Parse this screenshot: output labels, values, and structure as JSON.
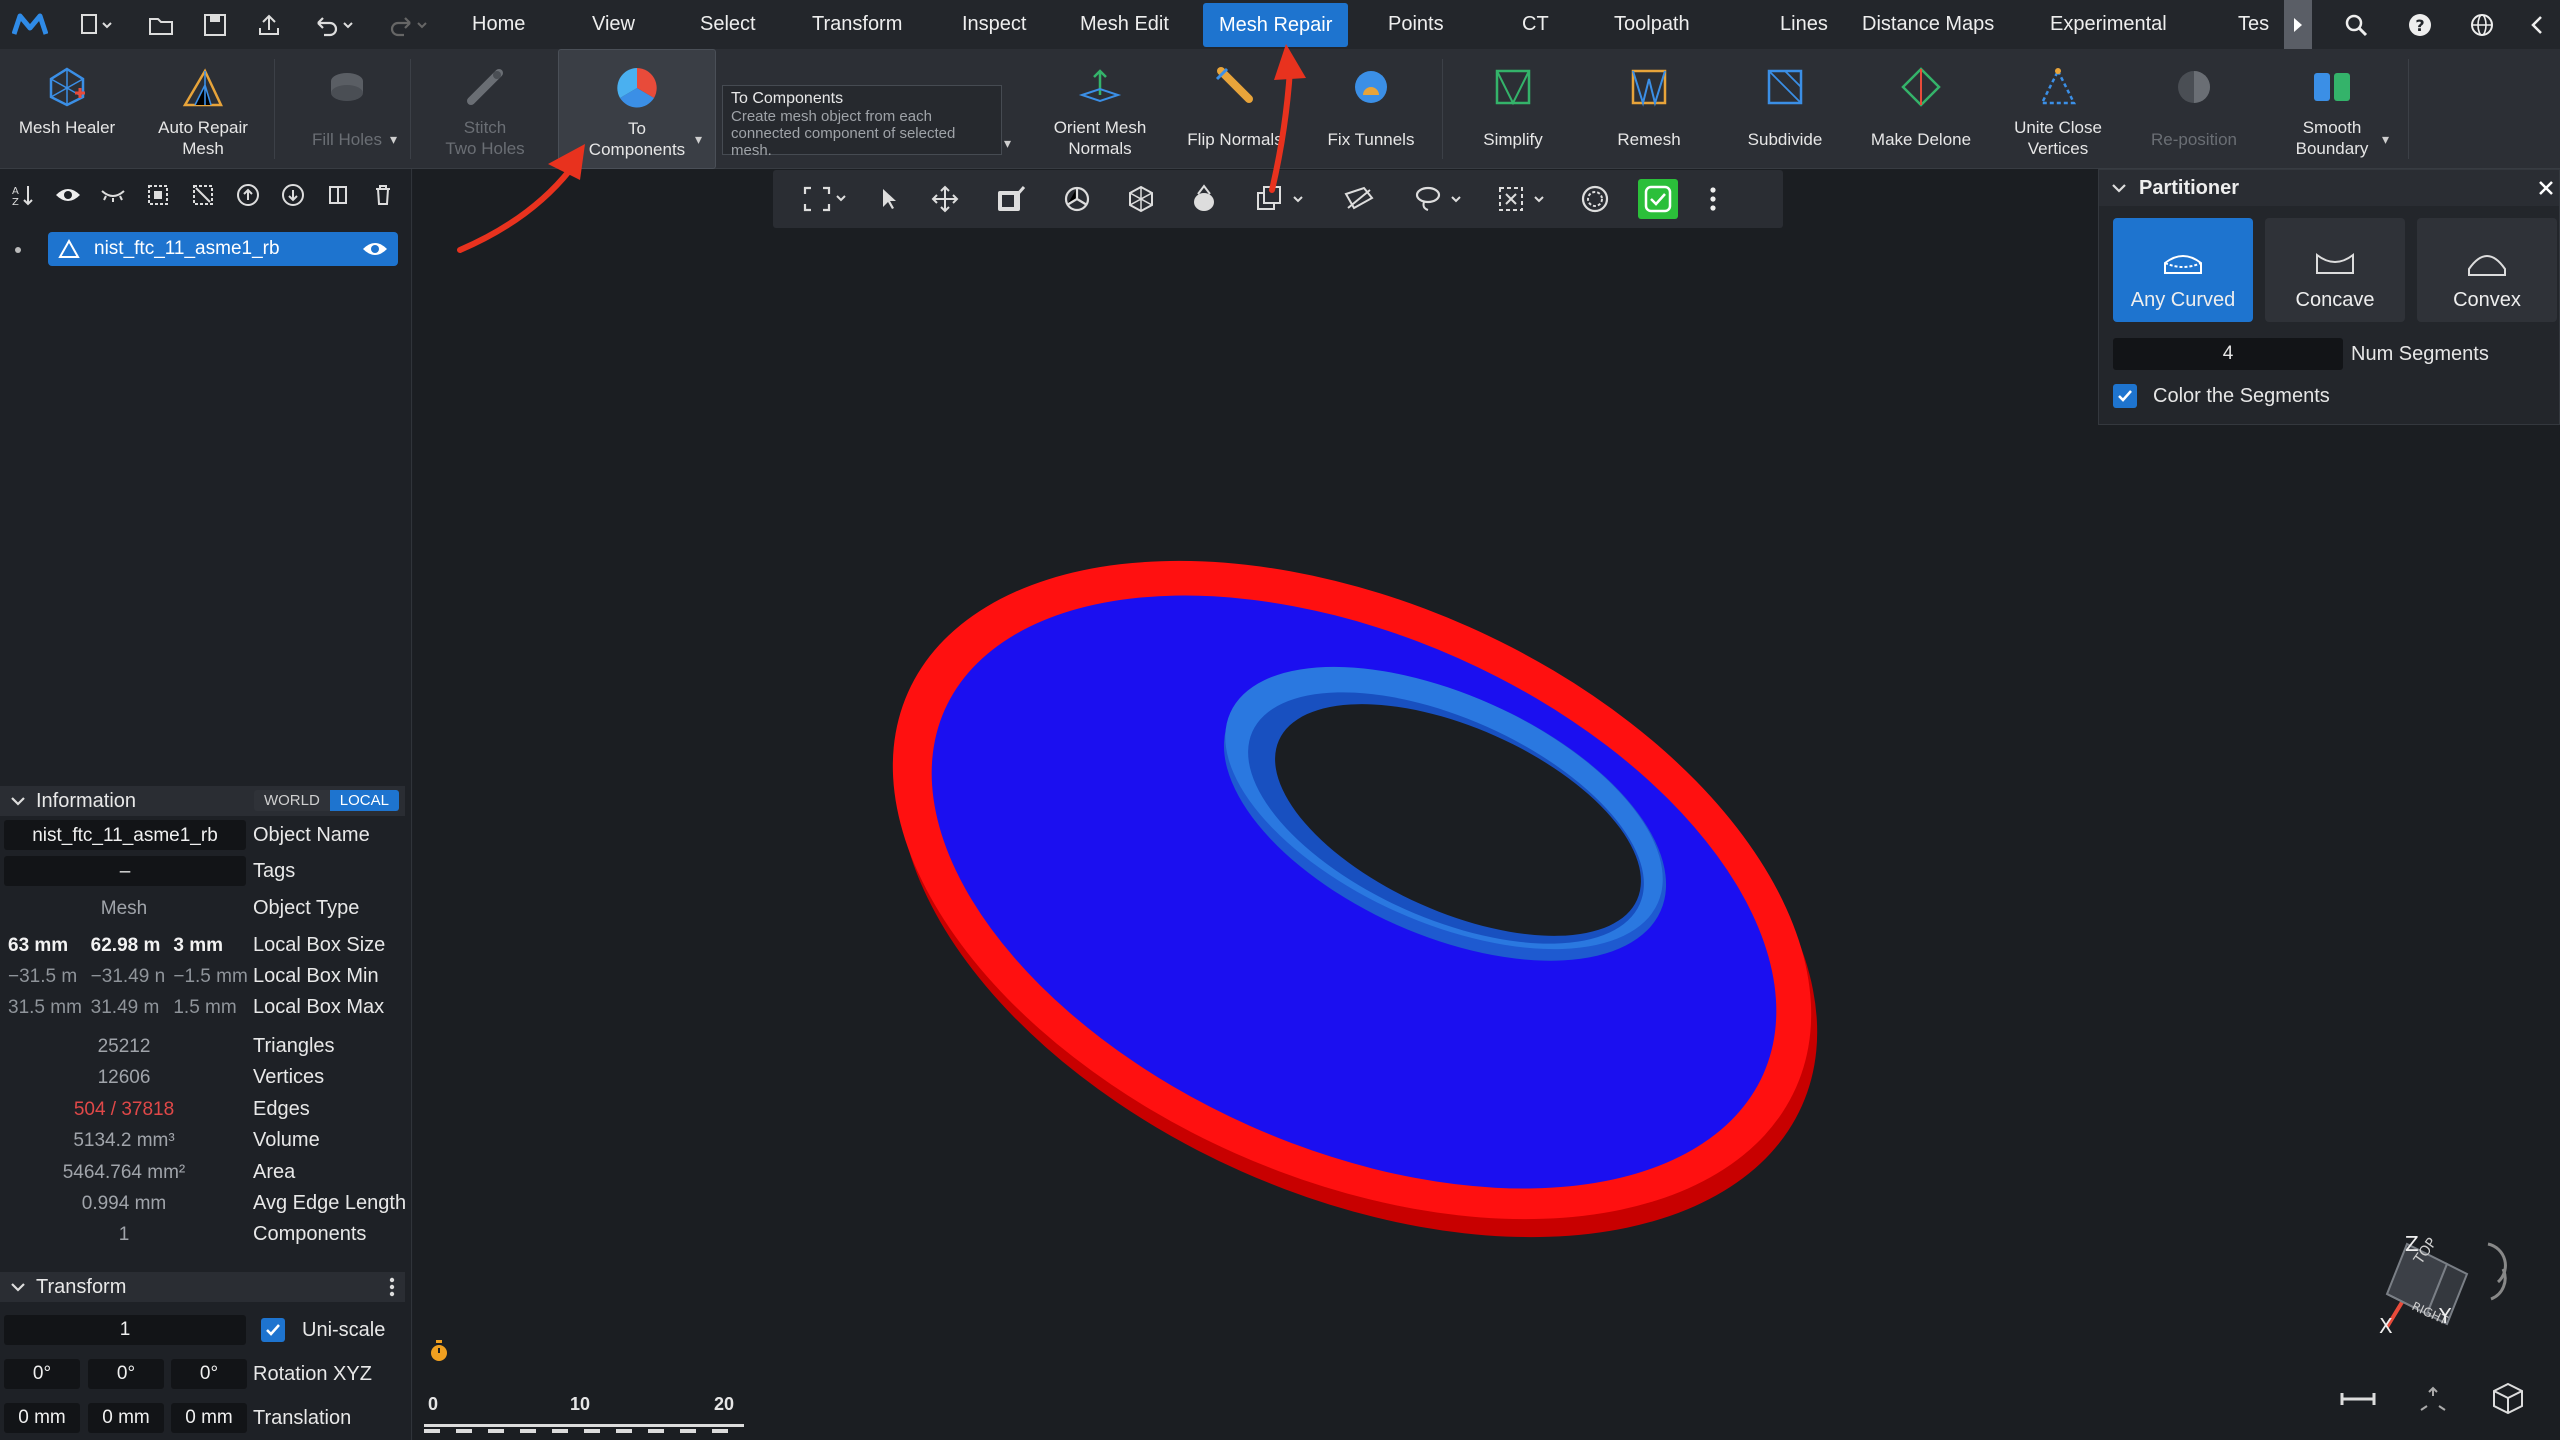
{
  "menubar": {
    "items": [
      "Home",
      "View",
      "Select",
      "Transform",
      "Inspect",
      "Mesh Edit",
      "Mesh Repair",
      "Points",
      "CT",
      "Toolpath",
      "Lines",
      "Distance Maps",
      "Experimental",
      "Tes"
    ],
    "active": "Mesh Repair"
  },
  "ribbon": {
    "mesh_healer": "Mesh Healer",
    "auto_repair": "Auto Repair\nMesh",
    "fill_holes": "Fill Holes",
    "stitch": "Stitch\nTwo Holes",
    "to_components": "To\nComponents",
    "orient_normals": "Orient Mesh\nNormals",
    "flip_normals": "Flip Normals",
    "fix_tunnels": "Fix Tunnels",
    "simplify": "Simplify",
    "remesh": "Remesh",
    "subdivide": "Subdivide",
    "make_delone": "Make Delone",
    "unite_vertices": "Unite Close\nVertices",
    "reposition": "Re-position",
    "smooth_boundary": "Smooth\nBoundary"
  },
  "tooltip": {
    "title": "To Components",
    "desc": "Create mesh object from each connected component of selected mesh."
  },
  "scene": {
    "object_name": "nist_ftc_11_asme1_rb"
  },
  "information": {
    "title": "Information",
    "world": "WORLD",
    "local": "LOCAL",
    "object_name_val": "nist_ftc_11_asme1_rb",
    "object_name_key": "Object Name",
    "tags_val": "–",
    "tags_key": "Tags",
    "type_val": "Mesh",
    "type_key": "Object Type",
    "box_size": [
      "63 mm",
      "62.98 m",
      "3 mm"
    ],
    "box_size_key": "Local Box Size",
    "box_min": [
      "−31.5 m",
      "−31.49 n",
      "−1.5 mm"
    ],
    "box_min_key": "Local Box Min",
    "box_max": [
      "31.5 mm",
      "31.49 m",
      "1.5 mm"
    ],
    "box_max_key": "Local Box Max",
    "triangles_val": "25212",
    "triangles_key": "Triangles",
    "vertices_val": "12606",
    "vertices_key": "Vertices",
    "edges_val": "504 / 37818",
    "edges_key": "Edges",
    "volume_val": "5134.2 mm³",
    "volume_key": "Volume",
    "area_val": "5464.764 mm²",
    "area_key": "Area",
    "avg_edge_val": "0.994 mm",
    "avg_edge_key": "Avg Edge Length",
    "components_val": "1",
    "components_key": "Components"
  },
  "transform": {
    "title": "Transform",
    "scale": "1",
    "uniscale": "Uni-scale",
    "rot": [
      "0°",
      "0°",
      "0°"
    ],
    "rot_key": "Rotation XYZ",
    "trans": [
      "0 mm",
      "0 mm",
      "0 mm"
    ],
    "trans_key": "Translation"
  },
  "partitioner": {
    "title": "Partitioner",
    "any_curved": "Any Curved",
    "concave": "Concave",
    "convex": "Convex",
    "num_segments_val": "4",
    "num_segments_key": "Num Segments",
    "color_segments": "Color the Segments"
  },
  "scalebar": {
    "labels": [
      "0",
      "10",
      "20"
    ]
  },
  "axes": {
    "z": "Z",
    "x": "X",
    "y": "Y",
    "top": "TOP",
    "right": "RIGHT"
  },
  "colors": {
    "accent": "#1e74cf",
    "ring_outer": "#ff0000",
    "ring_face": "#1a10f0",
    "ring_inner": "#1e5ad0",
    "annotation": "#e8321e"
  }
}
